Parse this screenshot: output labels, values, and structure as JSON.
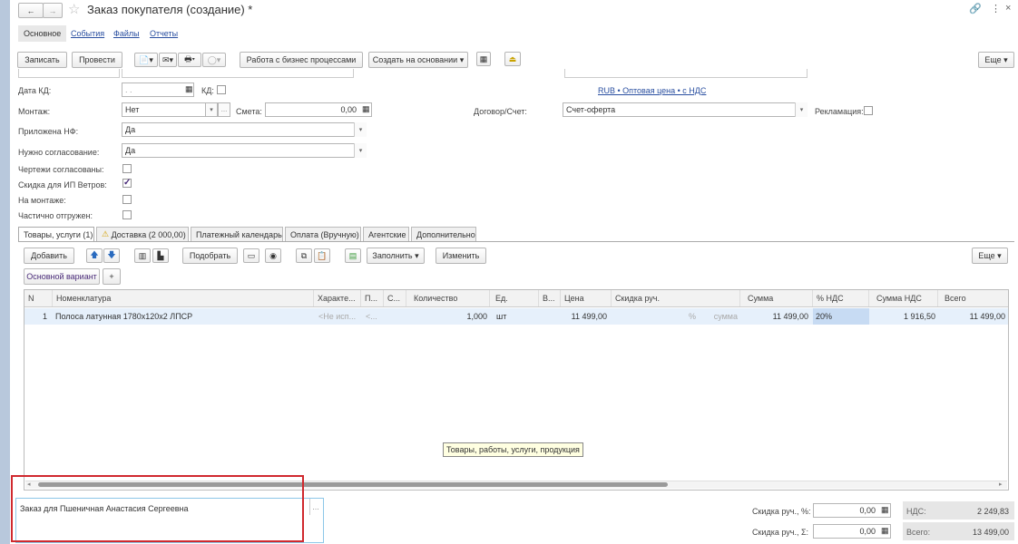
{
  "window": {
    "title": "Заказ покупателя (создание) *"
  },
  "nav_tabs": [
    "Основное",
    "События",
    "Файлы",
    "Отчеты"
  ],
  "toolbar": {
    "write": "Записать",
    "post": "Провести",
    "bp": "Работа с бизнес процессами",
    "create_based": "Создать на основании",
    "more": "Еще"
  },
  "form": {
    "date_kd_label": "Дата КД:",
    "date_kd_value": ". .",
    "kd_label": "КД:",
    "montage_label": "Монтаж:",
    "montage_value": "Нет",
    "smeta_label": "Смета:",
    "smeta_value": "0,00",
    "contract_label": "Договор/Счет:",
    "contract_value": "Счет-оферта",
    "price_link": "RUB • Оптовая цена • с НДС",
    "reclamation_label": "Рекламация:",
    "nf_label": "Приложена НФ:",
    "nf_value": "Да",
    "approval_label": "Нужно согласование:",
    "approval_value": "Да",
    "drawings_label": "Чертежи согласованы:",
    "discount_label": "Скидка для ИП Ветров:",
    "on_montage_label": "На монтаже:",
    "partial_label": "Частично отгружен:"
  },
  "tabs": [
    "Товары, услуги (1)",
    "Доставка (2 000,00)",
    "Платежный календарь",
    "Оплата (Вручную)",
    "Агентские",
    "Дополнительно"
  ],
  "goods_toolbar": {
    "add": "Добавить",
    "pick": "Подобрать",
    "fill": "Заполнить",
    "change": "Изменить",
    "more": "Еще",
    "variant": "Основной вариант",
    "plus": "+"
  },
  "table": {
    "headers": [
      "N",
      "Номенклатура",
      "Характе...",
      "П...",
      "С...",
      "Количество",
      "Ед.",
      "В...",
      "Цена",
      "Скидка руч.",
      "Сумма",
      "% НДС",
      "Сумма НДС",
      "Всего"
    ],
    "row": {
      "n": "1",
      "name": "Полоса латунная 1780х120х2 ЛПСР",
      "char": "<Не исп...",
      "p": "<...",
      "qty": "1,000",
      "unit": "шт",
      "price": "11 499,00",
      "disc_pct": "%",
      "disc_sum": "сумма",
      "sum": "11 499,00",
      "vat_rate": "20%",
      "vat_sum": "1 916,50",
      "total": "11 499,00"
    },
    "tooltip": "Товары, работы, услуги, продукция"
  },
  "footer": {
    "comment": "Заказ для Пшеничная Анастасия Сергеевна",
    "disc_pct_label": "Скидка руч., %:",
    "disc_pct_value": "0,00",
    "disc_sum_label": "Скидка руч., Σ:",
    "disc_sum_value": "0,00",
    "vat_label": "НДС:",
    "vat_value": "2 249,83",
    "total_label": "Всего:",
    "total_value": "13 499,00"
  }
}
